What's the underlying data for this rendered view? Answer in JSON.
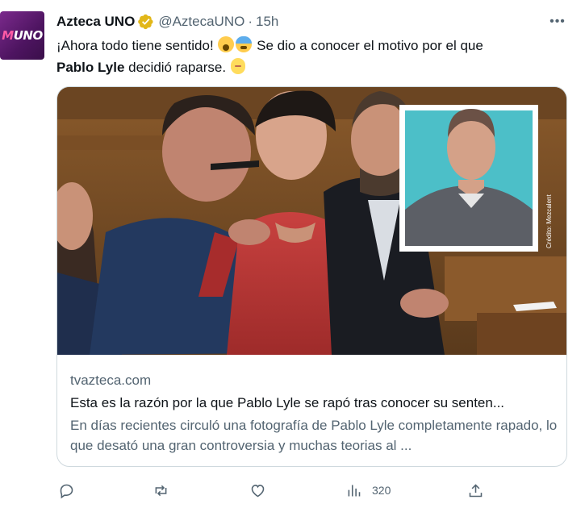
{
  "tweet": {
    "avatar_logo": "UNO",
    "display_name": "Azteca UNO",
    "handle": "@AztecaUNO",
    "separator": "·",
    "time": "15h",
    "more_label": "•••",
    "text_part1": "¡Ahora todo tiene sentido! ",
    "text_part2": " Se dio a conocer el motivo por el que ",
    "text_bold": "Pablo Lyle",
    "text_part3": " decidió raparse. ",
    "emojis": [
      "face-screaming-emoji",
      "fearful-face-emoji",
      "bald-person-emoji"
    ]
  },
  "card": {
    "image_credit": "Crédito: Mezcalent",
    "domain": "tvazteca.com",
    "title": "Esta es la razón por la que Pablo Lyle se rapó tras conocer su senten...",
    "description": "En días recientes circuló una fotografía de Pablo Lyle completamente rapado, lo que desató una gran controversia y muchas teorias al ..."
  },
  "actions": {
    "reply_icon": "reply-icon",
    "retweet_icon": "retweet-icon",
    "like_icon": "heart-icon",
    "views_icon": "views-chart-icon",
    "views_count": "320",
    "share_icon": "share-icon"
  },
  "colors": {
    "primary_text": "#0f1419",
    "secondary_text": "#536471",
    "border": "#cfd9de",
    "verified_gold": "#e2b719",
    "avatar_purple": "#4d1460"
  }
}
